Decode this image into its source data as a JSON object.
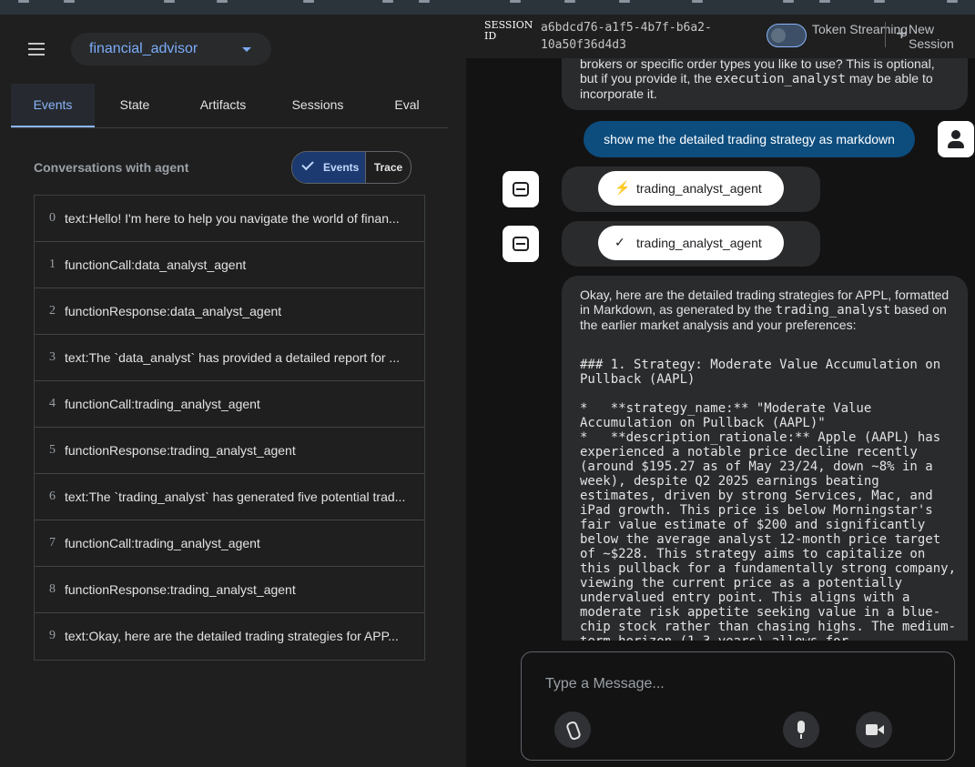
{
  "app": {
    "selected_app": "financial_advisor"
  },
  "tabs": [
    "Events",
    "State",
    "Artifacts",
    "Sessions",
    "Eval"
  ],
  "events_panel": {
    "title": "Conversations with agent",
    "toggle": {
      "events": "Events",
      "trace": "Trace"
    },
    "items": [
      {
        "index": "0",
        "text": "text:Hello! I'm here to help you navigate the world of finan..."
      },
      {
        "index": "1",
        "text": "functionCall:data_analyst_agent"
      },
      {
        "index": "2",
        "text": "functionResponse:data_analyst_agent"
      },
      {
        "index": "3",
        "text": "text:The `data_analyst` has provided a detailed report for ..."
      },
      {
        "index": "4",
        "text": "functionCall:trading_analyst_agent"
      },
      {
        "index": "5",
        "text": "functionResponse:trading_analyst_agent"
      },
      {
        "index": "6",
        "text": "text:The `trading_analyst` has generated five potential trad..."
      },
      {
        "index": "7",
        "text": "functionCall:trading_analyst_agent"
      },
      {
        "index": "8",
        "text": "functionResponse:trading_analyst_agent"
      },
      {
        "index": "9",
        "text": "text:Okay, here are the detailed trading strategies for APP..."
      }
    ]
  },
  "header": {
    "session_label": "SESSION ID",
    "session_id": "a6bdcd76-a1f5-4b7f-b6a2-10a50f36d4d3",
    "token_streaming_label": "Token Streaming",
    "new_session_label": "New Session",
    "new_session_icon": "+"
  },
  "chat": {
    "prev_message": {
      "part1": "brokers or specific order types you like to use? This is optional, but if you provide it, the ",
      "code": "execution_analyst",
      "part2": " may be able to incorporate it."
    },
    "user_message": "show me the detailed trading strategy as markdown",
    "function_call_label": "trading_analyst_agent",
    "function_response_label": "trading_analyst_agent",
    "function_call_icon": "⚡",
    "function_response_icon": "✓",
    "response": {
      "intro_part1": "Okay, here are the detailed trading strategies for APPL, formatted in Markdown, as generated by the ",
      "intro_code": "trading_analyst",
      "intro_part2": " based on the earlier market analysis and your preferences:",
      "markdown": "### 1. Strategy: Moderate Value Accumulation on Pullback (AAPL)\n\n*   **strategy_name:** \"Moderate Value Accumulation on Pullback (AAPL)\"\n*   **description_rationale:** Apple (AAPL) has experienced a notable price decline recently (around $195.27 as of May 23/24, down ~8% in a week), despite Q2 2025 earnings beating estimates, driven by strong Services, Mac, and iPad growth. This price is below Morningstar's fair value estimate of $200 and significantly below the average analyst 12-month price target of ~$228. This strategy aims to capitalize on this pullback for a fundamentally strong company, viewing the current price as a potentially undervalued entry point. This aligns with a moderate risk appetite seeking value in a blue-chip stock rather than chasing highs. The medium-term horizon (1-3 years) allows for"
    }
  },
  "input": {
    "placeholder": "Type a Message..."
  }
}
